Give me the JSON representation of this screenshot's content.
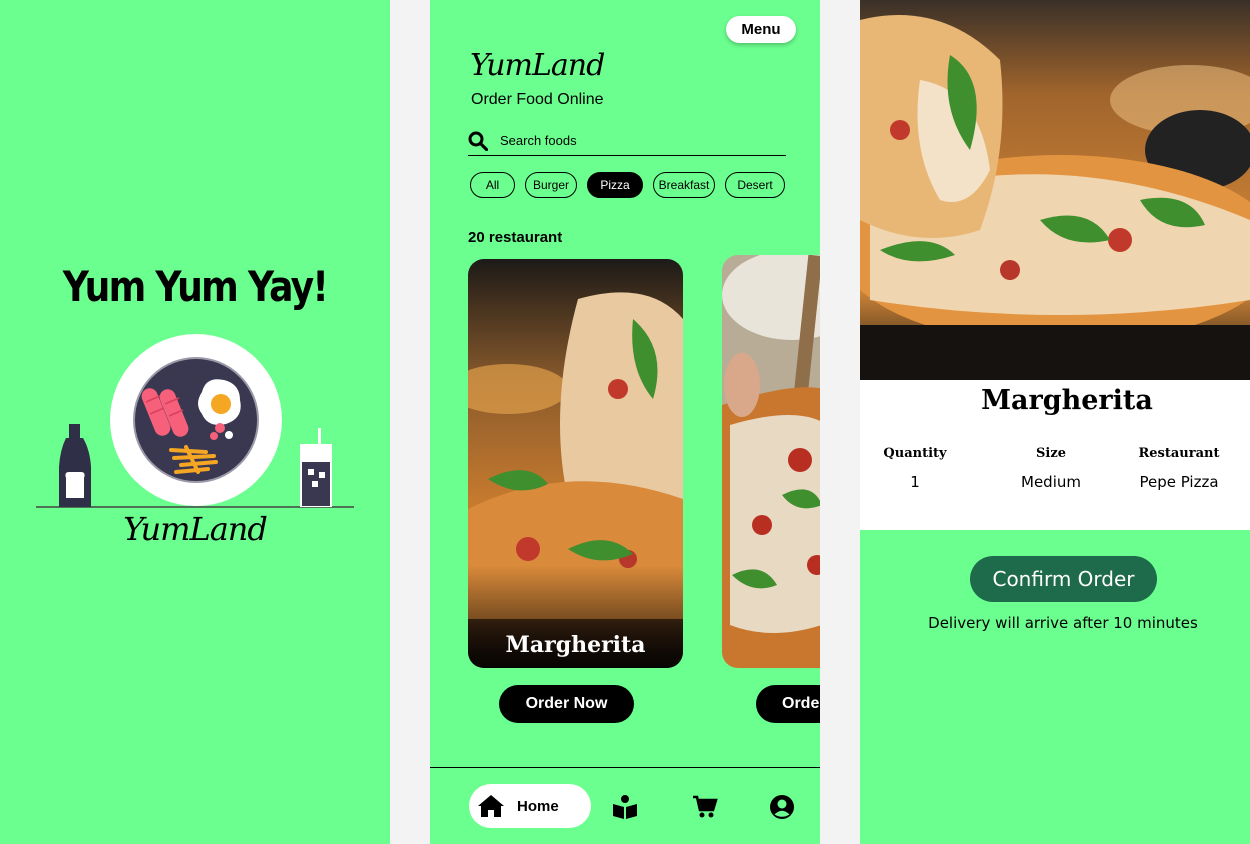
{
  "colors": {
    "background": "#6bff8f",
    "accent": "#1d6b4a",
    "dark": "#000000"
  },
  "splash": {
    "title": "Yum Yum Yay!",
    "logo": "YumLand"
  },
  "home": {
    "menu_label": "Menu",
    "brand": "YumLand",
    "subtitle": "Order Food Online",
    "search_placeholder": "Search foods",
    "categories": [
      {
        "label": "All",
        "active": false
      },
      {
        "label": "Burger",
        "active": false
      },
      {
        "label": "Pizza",
        "active": true
      },
      {
        "label": "Breakfast",
        "active": false
      },
      {
        "label": "Desert",
        "active": false
      }
    ],
    "restaurant_count": "20 restaurant",
    "cards": [
      {
        "title": "Margherita",
        "button_label": "Order Now"
      },
      {
        "title": "",
        "button_label": "Order Now"
      }
    ],
    "nav": {
      "home_label": "Home",
      "icons": [
        "home-icon",
        "menu-book-icon",
        "cart-icon",
        "profile-icon"
      ]
    }
  },
  "detail": {
    "title": "Margherita",
    "info": [
      {
        "label": "Quantity",
        "value": "1"
      },
      {
        "label": "Size",
        "value": "Medium"
      },
      {
        "label": "Restaurant",
        "value": "Pepe Pizza"
      }
    ],
    "confirm_label": "Confirm Order",
    "delivery_text": "Delivery will arrive after 10 minutes"
  }
}
